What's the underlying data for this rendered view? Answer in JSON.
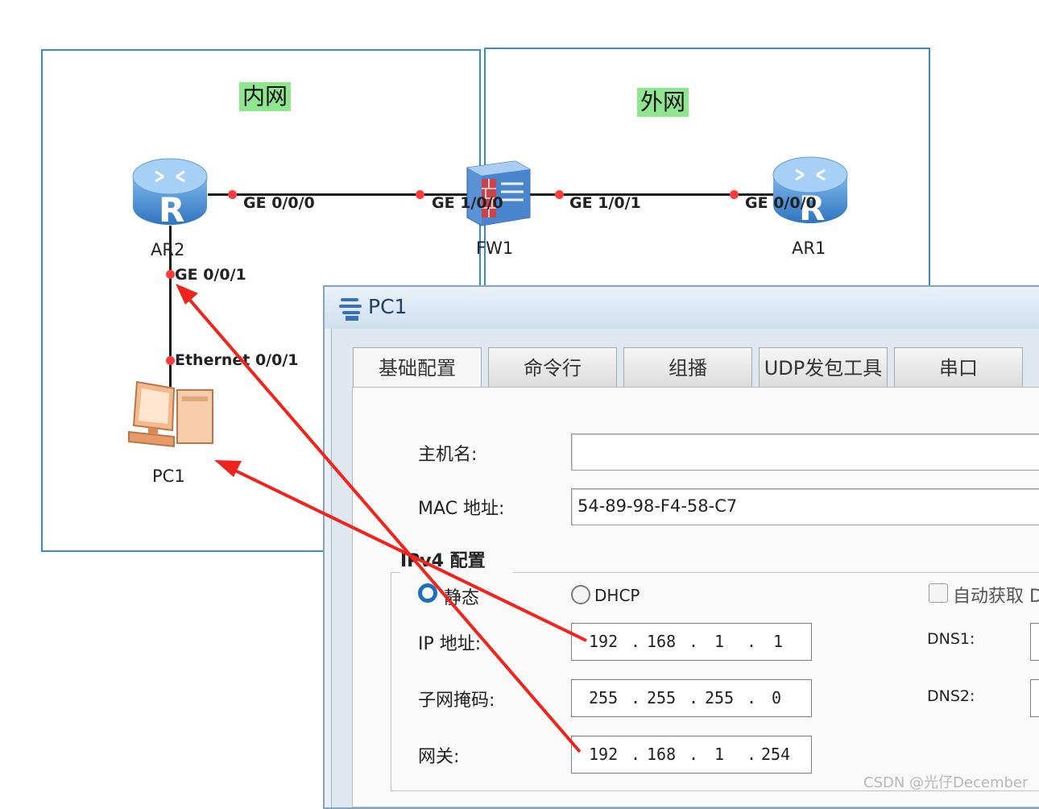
{
  "topology": {
    "zones": {
      "inner": "内网",
      "outer": "外网"
    },
    "devices": {
      "ar2": "AR2",
      "fw1": "FW1",
      "ar1": "AR1",
      "pc1": "PC1"
    },
    "ports": {
      "ar2_ge000": "GE 0/0/0",
      "fw1_ge100": "GE 1/0/0",
      "fw1_ge101": "GE 1/0/1",
      "ar1_ge000": "GE 0/0/0",
      "ar2_ge001": "GE 0/0/1",
      "pc1_eth": "Ethernet 0/0/1"
    }
  },
  "dialog": {
    "title": "PC1",
    "tabs": [
      "基础配置",
      "命令行",
      "组播",
      "UDP发包工具",
      "串口"
    ],
    "active_tab": "基础配置",
    "hostname_label": "主机名:",
    "hostname_value": "",
    "mac_label": "MAC 地址:",
    "mac_value": "54-89-98-F4-58-C7",
    "ipv4_section": "IPv4 配置",
    "static_label": "静态",
    "dhcp_label": "DHCP",
    "auto_dns_label": "自动获取 D",
    "ip_label": "IP 地址:",
    "ip": [
      "192",
      "168",
      "1",
      "1"
    ],
    "mask_label": "子网掩码:",
    "mask": [
      "255",
      "255",
      "255",
      "0"
    ],
    "gateway_label": "网关:",
    "gateway": [
      "192",
      "168",
      "1",
      "254"
    ],
    "dns1_label": "DNS1:",
    "dns2_label": "DNS2:",
    "mode": "static"
  },
  "watermark": "CSDN @光仔December",
  "colors": {
    "zone_border": "#3b8ad9",
    "zone_label_bg": "#8fe68f",
    "port_dot": "#ff3b3b",
    "arrow": "#f0231d"
  }
}
